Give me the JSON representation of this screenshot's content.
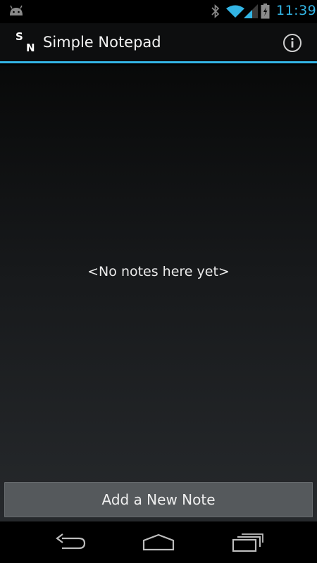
{
  "status_bar": {
    "time": "11:39",
    "icons": [
      "android-notification-icon",
      "bluetooth-icon",
      "wifi-icon",
      "signal-icon",
      "battery-charging-icon"
    ],
    "accent_color": "#33b5e5"
  },
  "action_bar": {
    "logo_letters": [
      "S",
      "N"
    ],
    "title": "Simple Notepad",
    "info_icon": "info-icon",
    "divider_color": "#33b5e5"
  },
  "content": {
    "empty_message": "<No notes here yet>",
    "add_button_label": "Add a New Note"
  },
  "nav_bar": {
    "buttons": [
      "back-icon",
      "home-icon",
      "recent-apps-icon"
    ]
  }
}
